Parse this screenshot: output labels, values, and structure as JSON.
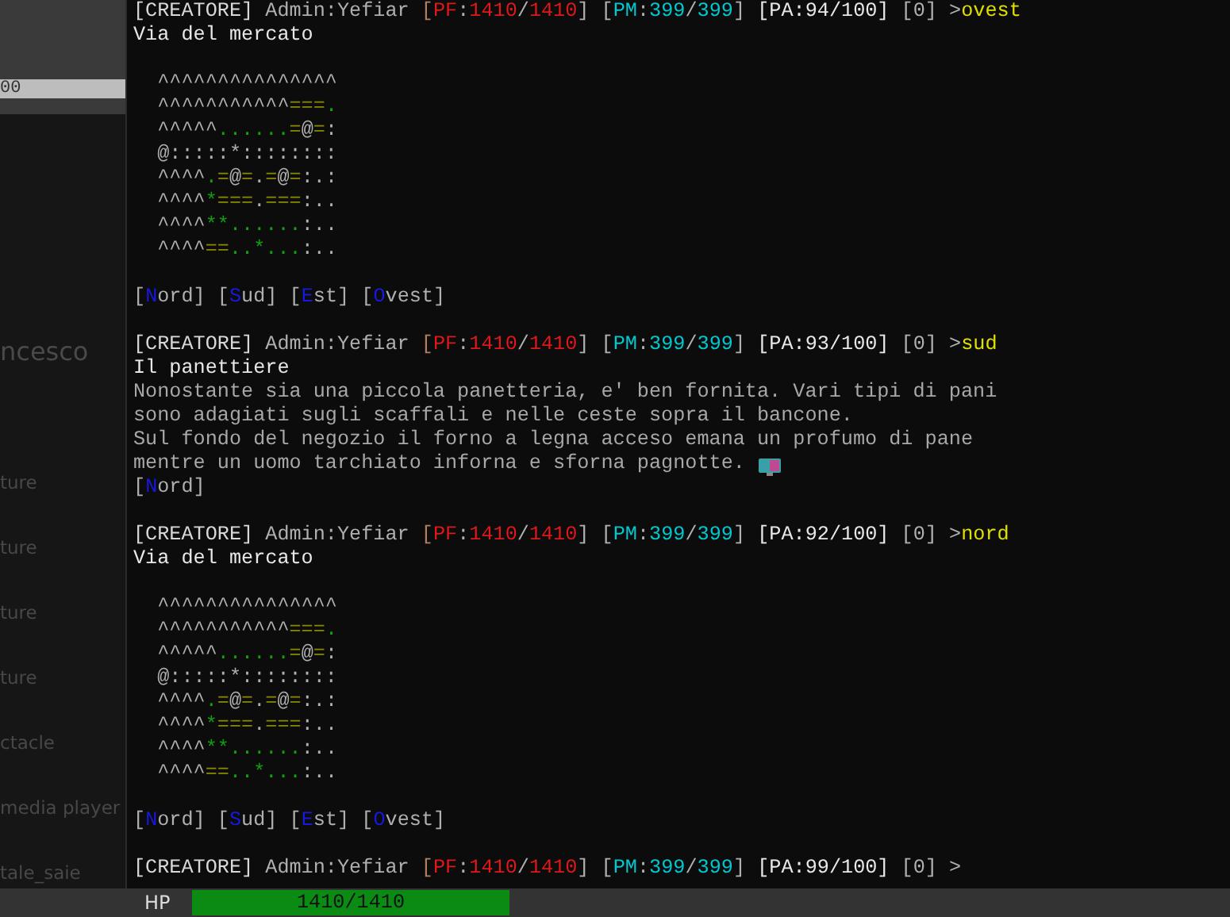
{
  "launcher": {
    "top_field": "00",
    "items": [
      {
        "text": "ncesco",
        "kind": "title"
      },
      {
        "text": "ture",
        "kind": "item"
      },
      {
        "text": "ture",
        "kind": "item"
      },
      {
        "text": "ture",
        "kind": "item"
      },
      {
        "text": "ture",
        "kind": "item"
      },
      {
        "text": "ctacle",
        "kind": "item"
      },
      {
        "text": "media player",
        "kind": "item"
      },
      {
        "text": "tale_saie",
        "kind": "item"
      }
    ]
  },
  "terminal": {
    "blocks": [
      {
        "lines": [
          [
            {
              "text": "[CREATORE]",
              "color": "#d8d8d8"
            },
            {
              "text": " Admin:Yefiar ",
              "color": "#b0b0b0"
            },
            {
              "text": "[",
              "color": "#b08060"
            },
            {
              "text": "PF",
              "color": "#e01818"
            },
            {
              "text": ":",
              "color": "#b0b0b0"
            },
            {
              "text": "1410",
              "color": "#e01818"
            },
            {
              "text": "/",
              "color": "#b0b0b0"
            },
            {
              "text": "1410",
              "color": "#e01818"
            },
            {
              "text": "] [",
              "color": "#b0b0b0"
            },
            {
              "text": "PM",
              "color": "#00c8d0"
            },
            {
              "text": ":",
              "color": "#b0b0b0"
            },
            {
              "text": "399",
              "color": "#00c8d0"
            },
            {
              "text": "/",
              "color": "#b0b0b0"
            },
            {
              "text": "399",
              "color": "#00c8d0"
            },
            {
              "text": "] ",
              "color": "#b0b0b0"
            },
            {
              "text": "[PA:94/100]",
              "color": "#e8e8e8"
            },
            {
              "text": " [0] >",
              "color": "#b0b0b0"
            },
            {
              "text": "ovest",
              "color": "#e0e000"
            }
          ],
          [
            {
              "text": "Via del mercato",
              "color": "#e8e8e8"
            }
          ]
        ]
      },
      {
        "lines": [
          [
            {
              "text": "  ^^^^^^^^^^^^^^^",
              "color": "#b0b0b0"
            }
          ],
          [
            {
              "text": "  ^^^^^^^^^^^",
              "color": "#b0b0b0"
            },
            {
              "text": "===",
              "color": "#8a8a00"
            },
            {
              "text": ".",
              "color": "#10a010"
            }
          ],
          [
            {
              "text": "  ^^^^^",
              "color": "#b0b0b0"
            },
            {
              "text": "......",
              "color": "#10a010"
            },
            {
              "text": "=",
              "color": "#8a8a00"
            },
            {
              "text": "@",
              "color": "#b0b0b0"
            },
            {
              "text": "=",
              "color": "#8a8a00"
            },
            {
              "text": ":",
              "color": "#b0b0b0"
            }
          ],
          [
            {
              "text": "  @:::::*::::::::",
              "color": "#b0b0b0"
            }
          ],
          [
            {
              "text": "  ^^^^",
              "color": "#b0b0b0"
            },
            {
              "text": ".",
              "color": "#10a010"
            },
            {
              "text": "=",
              "color": "#8a8a00"
            },
            {
              "text": "@",
              "color": "#b0b0b0"
            },
            {
              "text": "=",
              "color": "#8a8a00"
            },
            {
              "text": ".",
              "color": "#b0b0b0"
            },
            {
              "text": "=",
              "color": "#8a8a00"
            },
            {
              "text": "@",
              "color": "#b0b0b0"
            },
            {
              "text": "=",
              "color": "#8a8a00"
            },
            {
              "text": ":.:",
              "color": "#b0b0b0"
            }
          ],
          [
            {
              "text": "  ^^^^",
              "color": "#b0b0b0"
            },
            {
              "text": "*",
              "color": "#10a010"
            },
            {
              "text": "===",
              "color": "#8a8a00"
            },
            {
              "text": ".",
              "color": "#b0b0b0"
            },
            {
              "text": "===",
              "color": "#8a8a00"
            },
            {
              "text": ":..",
              "color": "#b0b0b0"
            }
          ],
          [
            {
              "text": "  ^^^^",
              "color": "#b0b0b0"
            },
            {
              "text": "**......",
              "color": "#10a010"
            },
            {
              "text": ":..",
              "color": "#b0b0b0"
            }
          ],
          [
            {
              "text": "  ^^^^",
              "color": "#b0b0b0"
            },
            {
              "text": "==",
              "color": "#8a8a00"
            },
            {
              "text": "..*...",
              "color": "#10a010"
            },
            {
              "text": ":..",
              "color": "#b0b0b0"
            }
          ]
        ]
      },
      {
        "lines": [
          [
            {
              "text": "[",
              "color": "#b0b0b0"
            },
            {
              "text": "N",
              "color": "#1818e0"
            },
            {
              "text": "ord] [",
              "color": "#b0b0b0"
            },
            {
              "text": "S",
              "color": "#1818e0"
            },
            {
              "text": "ud] [",
              "color": "#b0b0b0"
            },
            {
              "text": "E",
              "color": "#1818e0"
            },
            {
              "text": "st] [",
              "color": "#b0b0b0"
            },
            {
              "text": "O",
              "color": "#1818e0"
            },
            {
              "text": "vest]",
              "color": "#b0b0b0"
            }
          ]
        ]
      },
      {
        "lines": [
          [
            {
              "text": "[CREATORE]",
              "color": "#d8d8d8"
            },
            {
              "text": " Admin:Yefiar ",
              "color": "#b0b0b0"
            },
            {
              "text": "[",
              "color": "#b08060"
            },
            {
              "text": "PF",
              "color": "#e01818"
            },
            {
              "text": ":",
              "color": "#b0b0b0"
            },
            {
              "text": "1410",
              "color": "#e01818"
            },
            {
              "text": "/",
              "color": "#b0b0b0"
            },
            {
              "text": "1410",
              "color": "#e01818"
            },
            {
              "text": "] [",
              "color": "#b0b0b0"
            },
            {
              "text": "PM",
              "color": "#00c8d0"
            },
            {
              "text": ":",
              "color": "#b0b0b0"
            },
            {
              "text": "399",
              "color": "#00c8d0"
            },
            {
              "text": "/",
              "color": "#b0b0b0"
            },
            {
              "text": "399",
              "color": "#00c8d0"
            },
            {
              "text": "] ",
              "color": "#b0b0b0"
            },
            {
              "text": "[PA:93/100]",
              "color": "#e8e8e8"
            },
            {
              "text": " [0] >",
              "color": "#b0b0b0"
            },
            {
              "text": "sud",
              "color": "#e0e000"
            }
          ],
          [
            {
              "text": "Il panettiere",
              "color": "#e8e8e8"
            }
          ],
          [
            {
              "text": "Nonostante sia una piccola panetteria, e' ben fornita. Vari tipi di pani",
              "color": "#a8a8a8"
            }
          ],
          [
            {
              "text": "sono adagiati sugli scaffali e nelle ceste sopra il bancone.",
              "color": "#a8a8a8"
            }
          ],
          [
            {
              "text": "Sul fondo del negozio il forno a legna acceso emana un profumo di pane",
              "color": "#a8a8a8"
            }
          ],
          [
            {
              "text": "mentre un uomo tarchiato inforna e sforna pagnotte.",
              "color": "#a8a8a8"
            }
          ],
          [
            {
              "text": "[",
              "color": "#b0b0b0"
            },
            {
              "text": "N",
              "color": "#1818e0"
            },
            {
              "text": "ord]",
              "color": "#b0b0b0"
            }
          ]
        ]
      },
      {
        "lines": [
          [
            {
              "text": "[CREATORE]",
              "color": "#d8d8d8"
            },
            {
              "text": " Admin:Yefiar ",
              "color": "#b0b0b0"
            },
            {
              "text": "[",
              "color": "#b08060"
            },
            {
              "text": "PF",
              "color": "#e01818"
            },
            {
              "text": ":",
              "color": "#b0b0b0"
            },
            {
              "text": "1410",
              "color": "#e01818"
            },
            {
              "text": "/",
              "color": "#b0b0b0"
            },
            {
              "text": "1410",
              "color": "#e01818"
            },
            {
              "text": "] [",
              "color": "#b0b0b0"
            },
            {
              "text": "PM",
              "color": "#00c8d0"
            },
            {
              "text": ":",
              "color": "#b0b0b0"
            },
            {
              "text": "399",
              "color": "#00c8d0"
            },
            {
              "text": "/",
              "color": "#b0b0b0"
            },
            {
              "text": "399",
              "color": "#00c8d0"
            },
            {
              "text": "] ",
              "color": "#b0b0b0"
            },
            {
              "text": "[PA:92/100]",
              "color": "#e8e8e8"
            },
            {
              "text": " [0] >",
              "color": "#b0b0b0"
            },
            {
              "text": "nord",
              "color": "#e0e000"
            }
          ],
          [
            {
              "text": "Via del mercato",
              "color": "#e8e8e8"
            }
          ]
        ]
      },
      {
        "lines": [
          [
            {
              "text": "  ^^^^^^^^^^^^^^^",
              "color": "#b0b0b0"
            }
          ],
          [
            {
              "text": "  ^^^^^^^^^^^",
              "color": "#b0b0b0"
            },
            {
              "text": "===",
              "color": "#8a8a00"
            },
            {
              "text": ".",
              "color": "#10a010"
            }
          ],
          [
            {
              "text": "  ^^^^^",
              "color": "#b0b0b0"
            },
            {
              "text": "......",
              "color": "#10a010"
            },
            {
              "text": "=",
              "color": "#8a8a00"
            },
            {
              "text": "@",
              "color": "#b0b0b0"
            },
            {
              "text": "=",
              "color": "#8a8a00"
            },
            {
              "text": ":",
              "color": "#b0b0b0"
            }
          ],
          [
            {
              "text": "  @:::::*::::::::",
              "color": "#b0b0b0"
            }
          ],
          [
            {
              "text": "  ^^^^",
              "color": "#b0b0b0"
            },
            {
              "text": ".",
              "color": "#10a010"
            },
            {
              "text": "=",
              "color": "#8a8a00"
            },
            {
              "text": "@",
              "color": "#b0b0b0"
            },
            {
              "text": "=",
              "color": "#8a8a00"
            },
            {
              "text": ".",
              "color": "#b0b0b0"
            },
            {
              "text": "=",
              "color": "#8a8a00"
            },
            {
              "text": "@",
              "color": "#b0b0b0"
            },
            {
              "text": "=",
              "color": "#8a8a00"
            },
            {
              "text": ":.:",
              "color": "#b0b0b0"
            }
          ],
          [
            {
              "text": "  ^^^^",
              "color": "#b0b0b0"
            },
            {
              "text": "*",
              "color": "#10a010"
            },
            {
              "text": "===",
              "color": "#8a8a00"
            },
            {
              "text": ".",
              "color": "#b0b0b0"
            },
            {
              "text": "===",
              "color": "#8a8a00"
            },
            {
              "text": ":..",
              "color": "#b0b0b0"
            }
          ],
          [
            {
              "text": "  ^^^^",
              "color": "#b0b0b0"
            },
            {
              "text": "**......",
              "color": "#10a010"
            },
            {
              "text": ":..",
              "color": "#b0b0b0"
            }
          ],
          [
            {
              "text": "  ^^^^",
              "color": "#b0b0b0"
            },
            {
              "text": "==",
              "color": "#8a8a00"
            },
            {
              "text": "..*...",
              "color": "#10a010"
            },
            {
              "text": ":..",
              "color": "#b0b0b0"
            }
          ]
        ]
      },
      {
        "lines": [
          [
            {
              "text": "[",
              "color": "#b0b0b0"
            },
            {
              "text": "N",
              "color": "#1818e0"
            },
            {
              "text": "ord] [",
              "color": "#b0b0b0"
            },
            {
              "text": "S",
              "color": "#1818e0"
            },
            {
              "text": "ud] [",
              "color": "#b0b0b0"
            },
            {
              "text": "E",
              "color": "#1818e0"
            },
            {
              "text": "st] [",
              "color": "#b0b0b0"
            },
            {
              "text": "O",
              "color": "#1818e0"
            },
            {
              "text": "vest]",
              "color": "#b0b0b0"
            }
          ]
        ]
      },
      {
        "lines": [
          [
            {
              "text": "[CREATORE]",
              "color": "#d8d8d8"
            },
            {
              "text": " Admin:Yefiar ",
              "color": "#b0b0b0"
            },
            {
              "text": "[",
              "color": "#b08060"
            },
            {
              "text": "PF",
              "color": "#e01818"
            },
            {
              "text": ":",
              "color": "#b0b0b0"
            },
            {
              "text": "1410",
              "color": "#e01818"
            },
            {
              "text": "/",
              "color": "#b0b0b0"
            },
            {
              "text": "1410",
              "color": "#e01818"
            },
            {
              "text": "] [",
              "color": "#b0b0b0"
            },
            {
              "text": "PM",
              "color": "#00c8d0"
            },
            {
              "text": ":",
              "color": "#b0b0b0"
            },
            {
              "text": "399",
              "color": "#00c8d0"
            },
            {
              "text": "/",
              "color": "#b0b0b0"
            },
            {
              "text": "399",
              "color": "#00c8d0"
            },
            {
              "text": "] ",
              "color": "#b0b0b0"
            },
            {
              "text": "[PA:99/100]",
              "color": "#e8e8e8"
            },
            {
              "text": " [0] >",
              "color": "#b0b0b0"
            }
          ]
        ]
      }
    ]
  },
  "status_bar": {
    "label": "HP",
    "value": "1410/1410",
    "level": 1.0
  }
}
